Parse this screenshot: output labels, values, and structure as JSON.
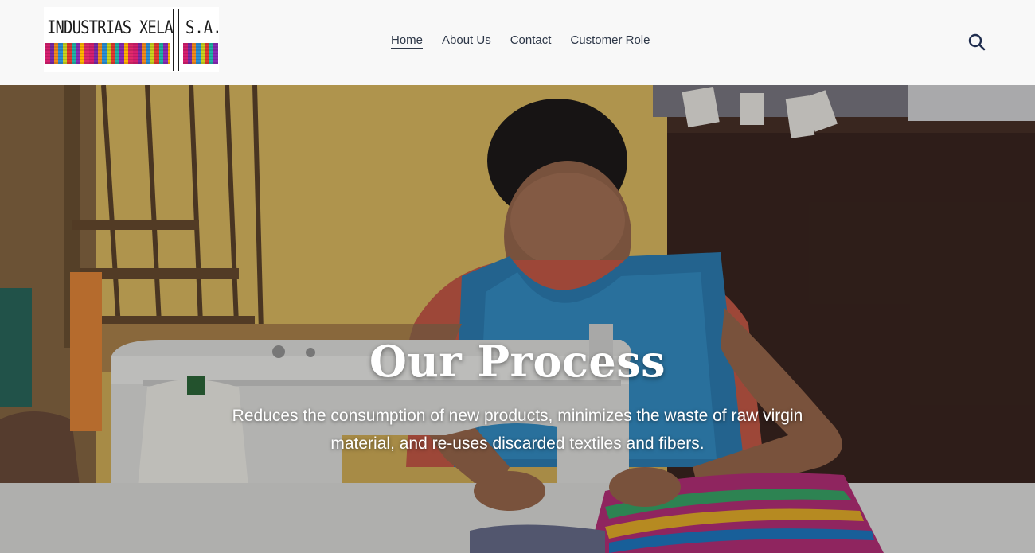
{
  "brand": {
    "logo_left": "INDUSTRIAS XELA",
    "logo_right": "S.A."
  },
  "nav": {
    "items": [
      {
        "label": "Home",
        "active": true
      },
      {
        "label": "About Us",
        "active": false
      },
      {
        "label": "Contact",
        "active": false
      },
      {
        "label": "Customer Role",
        "active": false
      }
    ]
  },
  "search": {
    "icon": "search-icon"
  },
  "hero": {
    "title": "Our Process",
    "subtitle": "Reduces the consumption of new products, minimizes the waste of raw virgin material, and re-uses discarded textiles and fibers."
  },
  "colors": {
    "header_bg": "#f8f8f8",
    "nav_text": "#2d3748",
    "hero_text": "#ffffff"
  }
}
